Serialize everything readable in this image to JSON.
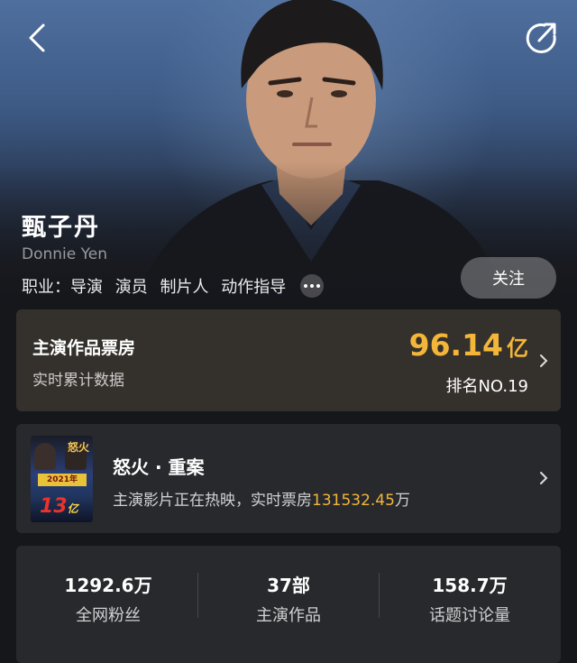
{
  "header": {
    "back_icon": "chevron-left-icon",
    "share_icon": "share-icon"
  },
  "profile": {
    "name_cn": "甄子丹",
    "name_en": "Donnie Yen",
    "profession_label": "职业：",
    "roles": [
      "导演",
      "演员",
      "制片人",
      "动作指导"
    ],
    "more_icon": "more-dots-icon",
    "follow_label": "关注"
  },
  "box_office": {
    "title": "主演作品票房",
    "subtitle": "实时累计数据",
    "value": "96.14",
    "unit": "亿",
    "rank": "排名NO.19",
    "accent_color": "#f3b63a"
  },
  "movie": {
    "title": "怒火 · 重案",
    "subtitle_prefix": "主演影片正在热映，实时票房",
    "box_value": "131532.45",
    "box_unit": "万",
    "poster": {
      "logo": "怒火",
      "year_banner": "2021年",
      "amount": "13",
      "amount_unit": "亿"
    }
  },
  "stats": [
    {
      "value": "1292.6万",
      "label": "全网粉丝"
    },
    {
      "value": "37部",
      "label": "主演作品"
    },
    {
      "value": "158.7万",
      "label": "话题讨论量"
    }
  ]
}
